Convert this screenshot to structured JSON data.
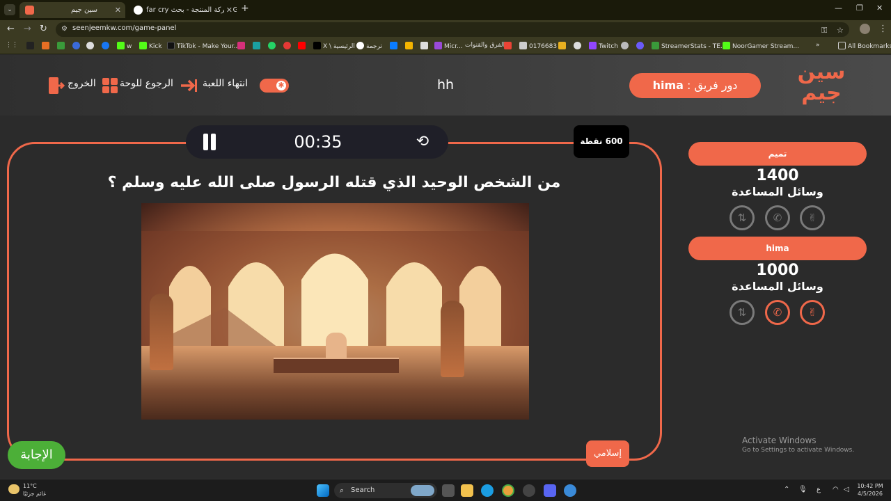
{
  "browser": {
    "tabs": [
      {
        "title": "سين جيم",
        "active": true
      },
      {
        "title": "far cry شركة المنتجة - بحث Goog",
        "active": false
      }
    ],
    "url": "seenjeemkw.com/game-panel",
    "bookmarks": [
      "w",
      "Kick",
      "TikTok - Make Your...",
      "X \\ الرئيسية",
      "ترجمة",
      "Micr...",
      "الفرق والقنوات |",
      "0176683",
      "Twitch",
      "StreamerStats - TE...",
      "NoorGamer Stream..."
    ],
    "all_bookmarks": "All Bookmarks"
  },
  "header": {
    "logo_line1": "سين",
    "logo_line2": "جيم",
    "turn_label": "دور فريق :",
    "turn_team": "hima",
    "game_title": "hh",
    "end_game": "انتهاء اللعبة",
    "back_to_board": "الرجوع للوحة",
    "exit": "الخروج",
    "toggle_on": true
  },
  "question_panel": {
    "timer": "00:35",
    "points": "600 نقطة",
    "question": "من الشخص الوحيد الذي قتله الرسول صلى الله عليه وسلم ؟",
    "category": "إسلامي",
    "answer_button": "الإجابة"
  },
  "teams": [
    {
      "name": "تميم",
      "score": "1400",
      "aids_label": "وسائل المساعدة",
      "aids": [
        {
          "icon": "peace-hand-icon",
          "active": false
        },
        {
          "icon": "phone-icon",
          "active": false
        },
        {
          "icon": "swap-icon",
          "active": false
        }
      ]
    },
    {
      "name": "hima",
      "score": "1000",
      "aids_label": "وسائل المساعدة",
      "aids": [
        {
          "icon": "peace-hand-icon",
          "active": true
        },
        {
          "icon": "phone-icon",
          "active": true
        },
        {
          "icon": "swap-icon",
          "active": false
        }
      ]
    }
  ],
  "watermark": {
    "line1": "Activate Windows",
    "line2": "Go to Settings to activate Windows."
  },
  "taskbar": {
    "temperature": "11°C",
    "weather_text": "غائم جزئيًا",
    "search_placeholder": "Search",
    "ime": "ع",
    "time": "10:42 PM",
    "date": "4/5/2026"
  },
  "colors": {
    "accent": "#f0684a",
    "answer_green": "#4caf38",
    "background": "#2b2b2b"
  }
}
